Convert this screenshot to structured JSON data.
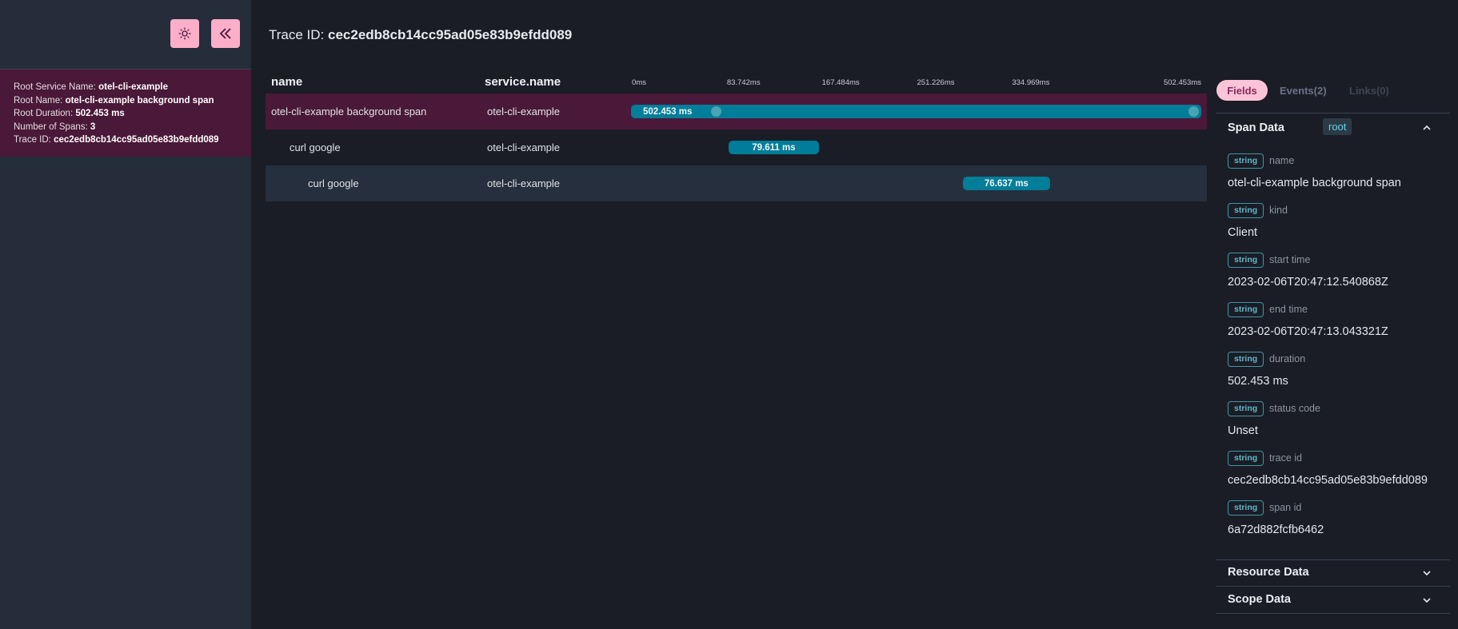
{
  "sidebar": {
    "theme_toggle_label": "Toggle theme",
    "collapse_label": "Collapse sidebar",
    "summary": {
      "root_service_name_label": "Root Service Name: ",
      "root_service_name": "otel-cli-example",
      "root_name_label": "Root Name: ",
      "root_name": "otel-cli-example background span",
      "root_duration_label": "Root Duration: ",
      "root_duration": "502.453 ms",
      "num_spans_label": "Number of Spans: ",
      "num_spans": "3",
      "trace_id_label": "Trace ID: ",
      "trace_id": "cec2edb8cb14cc95ad05e83b9efdd089"
    }
  },
  "main": {
    "trace_title_label": "Trace ID: ",
    "trace_id": "cec2edb8cb14cc95ad05e83b9efdd089",
    "columns": {
      "name": "name",
      "service": "service.name"
    },
    "ticks": [
      "0ms",
      "83.742ms",
      "167.484ms",
      "251.226ms",
      "334.969ms",
      "502.453ms"
    ],
    "tick_fractions": [
      0,
      0.1667,
      0.3333,
      0.5,
      0.6667,
      1.0
    ],
    "trace_duration_ms": 502.453,
    "spans": [
      {
        "name": "otel-cli-example background span",
        "service": "otel-cli-example",
        "duration_label": "502.453 ms",
        "duration_ms": 502.453,
        "start_fraction": 0.0,
        "depth": 0,
        "selected": true
      },
      {
        "name": "curl google",
        "service": "otel-cli-example",
        "duration_label": "79.611 ms",
        "duration_ms": 79.611,
        "start_fraction": 0.171,
        "depth": 1,
        "selected": false
      },
      {
        "name": "curl google",
        "service": "otel-cli-example",
        "duration_label": "76.637 ms",
        "duration_ms": 76.637,
        "start_fraction": 0.582,
        "depth": 2,
        "selected": false
      }
    ]
  },
  "panel": {
    "tabs": {
      "fields": "Fields",
      "events": "Events(2)",
      "links": "Links(0)"
    },
    "span_data": {
      "title": "Span Data",
      "badge": "root",
      "fields": [
        {
          "type": "string",
          "key": "name",
          "value": "otel-cli-example background span"
        },
        {
          "type": "string",
          "key": "kind",
          "value": "Client"
        },
        {
          "type": "string",
          "key": "start time",
          "value": "2023-02-06T20:47:12.540868Z"
        },
        {
          "type": "string",
          "key": "end time",
          "value": "2023-02-06T20:47:13.043321Z"
        },
        {
          "type": "string",
          "key": "duration",
          "value": "502.453 ms"
        },
        {
          "type": "string",
          "key": "status code",
          "value": "Unset"
        },
        {
          "type": "string",
          "key": "trace id",
          "value": "cec2edb8cb14cc95ad05e83b9efdd089"
        },
        {
          "type": "string",
          "key": "span id",
          "value": "6a72d882fcfb6462"
        }
      ]
    },
    "resource_data": {
      "title": "Resource Data"
    },
    "scope_data": {
      "title": "Scope Data"
    }
  },
  "colors": {
    "accent_pink": "#fdaec9",
    "selected_row": "#4a1838",
    "bar_teal": "#007d98"
  }
}
